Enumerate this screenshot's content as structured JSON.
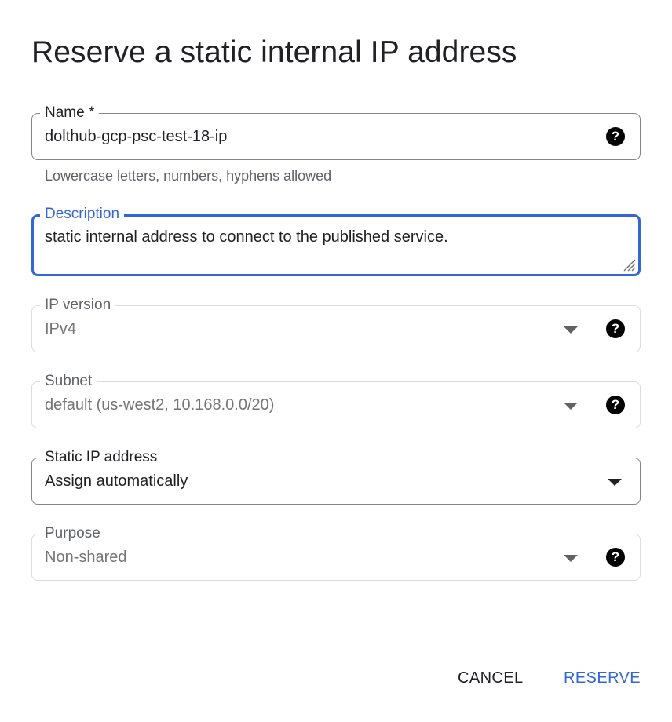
{
  "dialog": {
    "title": "Reserve a static internal IP address"
  },
  "fields": {
    "name": {
      "label": "Name *",
      "value": "dolthub-gcp-psc-test-18-ip",
      "hint": "Lowercase letters, numbers, hyphens allowed",
      "help_icon": "help-icon"
    },
    "description": {
      "label": "Description",
      "value": "static internal address to connect to the published service."
    },
    "ip_version": {
      "label": "IP version",
      "value": "IPv4",
      "help_icon": "help-icon"
    },
    "subnet": {
      "label": "Subnet",
      "value": "default (us-west2, 10.168.0.0/20)",
      "help_icon": "help-icon"
    },
    "static_ip": {
      "label": "Static IP address",
      "value": "Assign automatically"
    },
    "purpose": {
      "label": "Purpose",
      "value": "Non-shared",
      "help_icon": "help-icon"
    }
  },
  "actions": {
    "cancel": "CANCEL",
    "reserve": "RESERVE"
  },
  "colors": {
    "accent": "#3367d6",
    "disabled_border": "#dadce0",
    "outline": "#80868b"
  }
}
